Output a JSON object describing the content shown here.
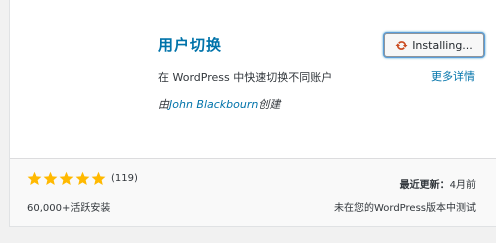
{
  "plugin": {
    "name": "用户切换",
    "description": "在 WordPress 中快速切换不同账户",
    "author_prefix": "由",
    "author_name": "John Blackbourn",
    "author_suffix": "创建"
  },
  "actions": {
    "install_label": "Installing...",
    "more_details": "更多详情"
  },
  "rating": {
    "stars": 5,
    "max_stars": 5,
    "count": "(119)"
  },
  "stats": {
    "active_installs": "60,000+活跃安装",
    "last_updated_label": "最近更新：",
    "last_updated_value": "4月前",
    "compatibility": "未在您的WordPress版本中测试"
  },
  "colors": {
    "link": "#0073aa",
    "star": "#ffb900",
    "spinner": "#ca4a1f"
  },
  "icons": {
    "install": "update-spin-icon",
    "star": "star-filled-icon"
  }
}
